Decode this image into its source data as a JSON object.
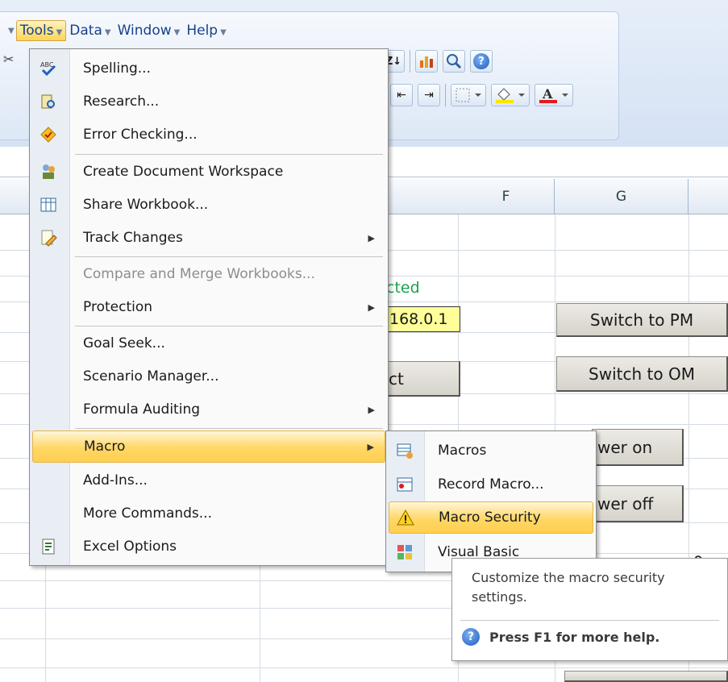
{
  "menubar": {
    "items": [
      {
        "label": "Tools",
        "active": true
      },
      {
        "label": "Data",
        "active": false
      },
      {
        "label": "Window",
        "active": false
      },
      {
        "label": "Help",
        "active": false
      }
    ]
  },
  "columns": [
    "F",
    "G"
  ],
  "sheet": {
    "connected_fragment": "cted",
    "ip_fragment": "168.0.1",
    "connect_fragment": "ct",
    "number_fragment": "0",
    "buttons": {
      "switch_pm": "Switch to PM",
      "switch_om": "Switch to OM",
      "power_on": "wer on",
      "power_off": "wer off"
    }
  },
  "tools_menu": {
    "items": [
      {
        "label": "Spelling...",
        "icon": "spelling-icon"
      },
      {
        "label": "Research...",
        "icon": "research-icon"
      },
      {
        "label": "Error Checking...",
        "icon": "error-checking-icon"
      },
      {
        "label": "Create Document Workspace",
        "icon": "workspace-icon"
      },
      {
        "label": "Share Workbook...",
        "icon": "share-workbook-icon"
      },
      {
        "label": "Track Changes",
        "icon": "track-changes-icon",
        "submenu": true
      },
      {
        "label": "Compare and Merge Workbooks...",
        "disabled": true
      },
      {
        "label": "Protection",
        "submenu": true
      },
      {
        "label": "Goal Seek..."
      },
      {
        "label": "Scenario Manager..."
      },
      {
        "label": "Formula Auditing",
        "submenu": true
      },
      {
        "label": "Macro",
        "submenu": true,
        "highlighted": true
      },
      {
        "label": "Add-Ins..."
      },
      {
        "label": "More Commands..."
      },
      {
        "label": "Excel Options",
        "icon": "excel-options-icon"
      }
    ]
  },
  "macro_menu": {
    "items": [
      {
        "label": "Macros",
        "icon": "macros-icon"
      },
      {
        "label": "Record Macro...",
        "icon": "record-macro-icon"
      },
      {
        "label": "Macro Security",
        "icon": "warning-icon",
        "highlighted": true
      },
      {
        "label": "Visual Basic",
        "icon": "visual-basic-icon"
      }
    ]
  },
  "tooltip": {
    "text": "Customize the macro security settings.",
    "help": "Press F1 for more help."
  },
  "colors": {
    "highlight": "#ffd766",
    "connected_text": "#1aa34a",
    "ip_cell_fill": "#ffff99"
  }
}
